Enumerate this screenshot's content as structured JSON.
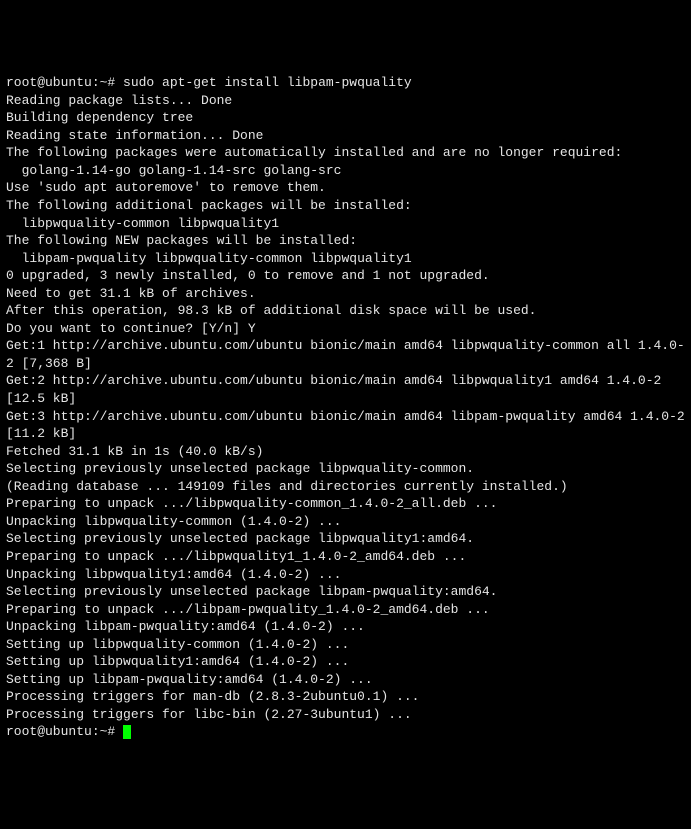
{
  "terminal": {
    "prompt1": "root@ubuntu:~# ",
    "command1": "sudo apt-get install libpam-pwquality",
    "lines": [
      "Reading package lists... Done",
      "Building dependency tree",
      "Reading state information... Done",
      "The following packages were automatically installed and are no longer required:",
      "  golang-1.14-go golang-1.14-src golang-src",
      "Use 'sudo apt autoremove' to remove them.",
      "The following additional packages will be installed:",
      "  libpwquality-common libpwquality1",
      "The following NEW packages will be installed:",
      "  libpam-pwquality libpwquality-common libpwquality1",
      "0 upgraded, 3 newly installed, 0 to remove and 1 not upgraded.",
      "Need to get 31.1 kB of archives.",
      "After this operation, 98.3 kB of additional disk space will be used.",
      "Do you want to continue? [Y/n] Y",
      "Get:1 http://archive.ubuntu.com/ubuntu bionic/main amd64 libpwquality-common all 1.4.0-2 [7,368 B]",
      "Get:2 http://archive.ubuntu.com/ubuntu bionic/main amd64 libpwquality1 amd64 1.4.0-2 [12.5 kB]",
      "Get:3 http://archive.ubuntu.com/ubuntu bionic/main amd64 libpam-pwquality amd64 1.4.0-2 [11.2 kB]",
      "Fetched 31.1 kB in 1s (40.0 kB/s)",
      "Selecting previously unselected package libpwquality-common.",
      "(Reading database ... 149109 files and directories currently installed.)",
      "Preparing to unpack .../libpwquality-common_1.4.0-2_all.deb ...",
      "Unpacking libpwquality-common (1.4.0-2) ...",
      "Selecting previously unselected package libpwquality1:amd64.",
      "Preparing to unpack .../libpwquality1_1.4.0-2_amd64.deb ...",
      "Unpacking libpwquality1:amd64 (1.4.0-2) ...",
      "Selecting previously unselected package libpam-pwquality:amd64.",
      "Preparing to unpack .../libpam-pwquality_1.4.0-2_amd64.deb ...",
      "Unpacking libpam-pwquality:amd64 (1.4.0-2) ...",
      "Setting up libpwquality-common (1.4.0-2) ...",
      "Setting up libpwquality1:amd64 (1.4.0-2) ...",
      "Setting up libpam-pwquality:amd64 (1.4.0-2) ...",
      "Processing triggers for man-db (2.8.3-2ubuntu0.1) ...",
      "Processing triggers for libc-bin (2.27-3ubuntu1) ..."
    ],
    "prompt2": "root@ubuntu:~# "
  }
}
